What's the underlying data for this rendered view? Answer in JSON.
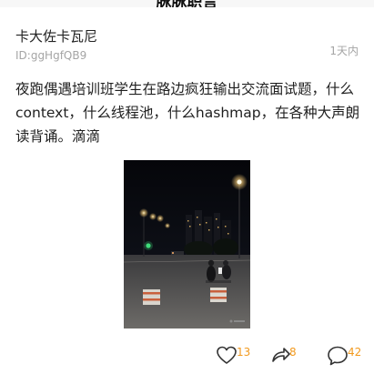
{
  "nav": {
    "title": "脉脉职言"
  },
  "post": {
    "author": "卡大佐卡瓦尼",
    "author_id": "ID:ggHgfQB9",
    "time": "1天内",
    "text": "夜跑偶遇培训班学生在路边疯狂输出交流面试题，什么context，什么线程池，什么hashmap，在各种大声朗读背诵。滴滴",
    "image_icon": "night-street-photo"
  },
  "actions": {
    "like_count": "13",
    "share_count": "8",
    "comment_count": "42",
    "like_icon": "heart-icon",
    "share_icon": "share-arrow-icon",
    "comment_icon": "comment-bubble-icon"
  },
  "colors": {
    "count": "#f29a1f",
    "meta": "#a5a5a5",
    "background": "#f7f7f7"
  }
}
